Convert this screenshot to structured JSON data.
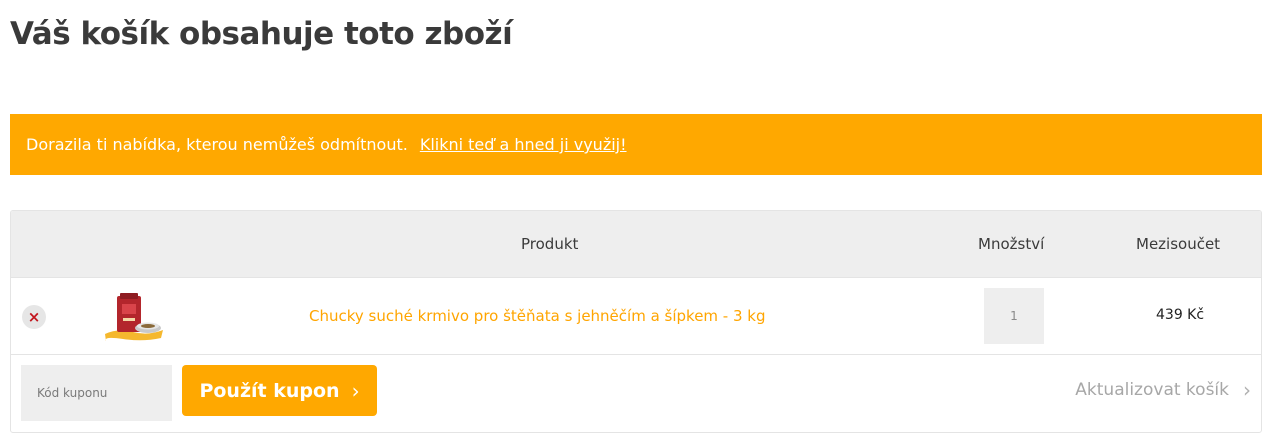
{
  "page": {
    "title": "Váš košík obsahuje toto zboží"
  },
  "notice": {
    "text": "Dorazila ti nabídka, kterou nemůžeš odmítnout.",
    "link": "Klikni teď a hned ji využij!"
  },
  "cart": {
    "columns": {
      "product": "Produkt",
      "quantity": "Množství",
      "subtotal": "Mezisoučet"
    },
    "items": [
      {
        "remove_icon": "×",
        "name": "Chucky suché krmivo pro štěňata s jehněčím a šípkem - 3 kg",
        "quantity": "1",
        "subtotal": "439 Kč"
      }
    ],
    "coupon": {
      "placeholder": "Kód kuponu",
      "apply_label": "Použít kupon",
      "apply_icon": "›"
    },
    "update": {
      "label": "Aktualizovat košík",
      "icon": "›"
    }
  },
  "colors": {
    "accent": "#ffa800",
    "product_link": "#ffa500",
    "remove": "#c2161e"
  },
  "icons": {
    "remove": "close-icon",
    "apply": "chevron-right-icon",
    "update": "chevron-right-icon"
  }
}
